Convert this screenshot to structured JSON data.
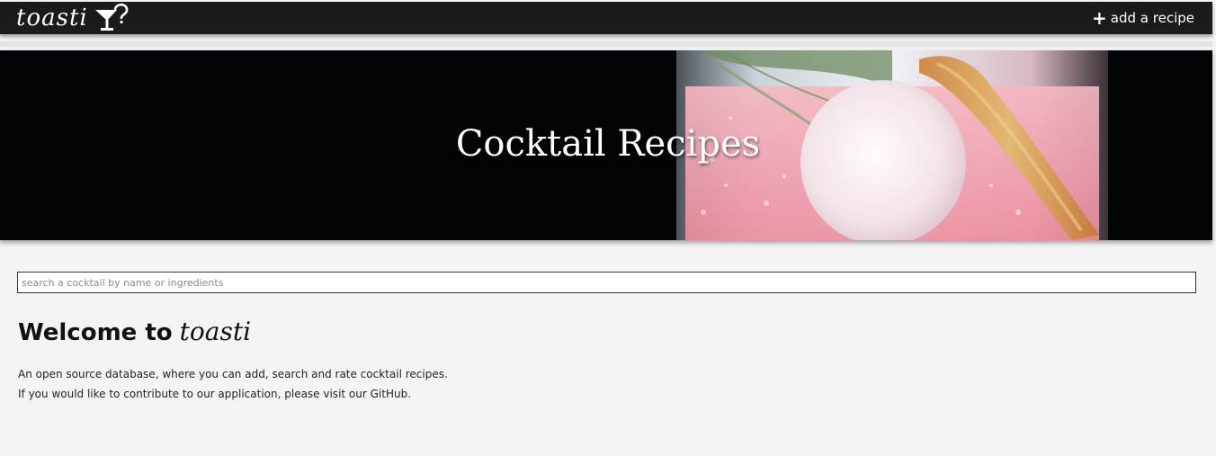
{
  "nav": {
    "brand": "toasti",
    "brand_icon": "cocktail-glass-icon",
    "add_icon": "+",
    "add_label": "add a recipe"
  },
  "hero": {
    "title": "Cocktail Recipes"
  },
  "search": {
    "placeholder": "search a cocktail by name or ingredients",
    "value": ""
  },
  "welcome": {
    "prefix": "Welcome to",
    "brand": "toasti"
  },
  "intro": {
    "line1": "An open source database, where you can add, search and rate cocktail recipes.",
    "line2_before": "If you would like to contribute to our application, please visit our ",
    "line2_link": "GitHub",
    "line2_after": "."
  },
  "colors": {
    "navbar": "#1b1b1b",
    "page_background": "#f4f4f4",
    "hero_background": "#030407",
    "drink_pink": "#f1a3b0"
  }
}
